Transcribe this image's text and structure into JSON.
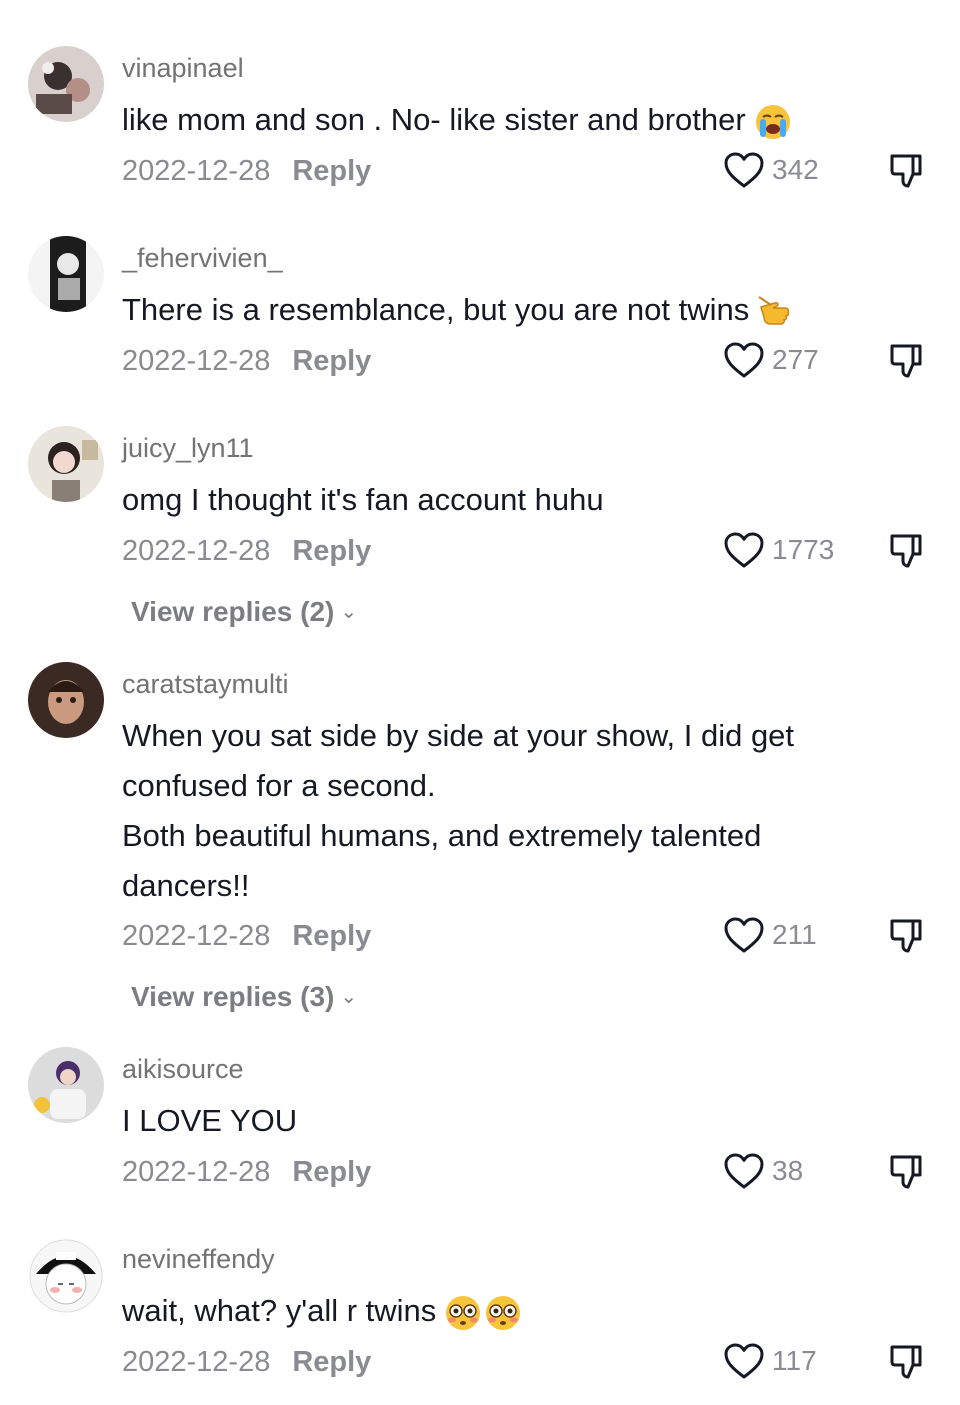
{
  "comments": [
    {
      "username": "vinapinael",
      "lines": [
        "like mom and son . No- like sister and brother"
      ],
      "emoji": [
        "loudly-crying-face"
      ],
      "date": "2022-12-28",
      "reply_label": "Reply",
      "likes": "342"
    },
    {
      "username": "_fehervivien_",
      "lines": [
        "There is a resemblance, but you are not twins"
      ],
      "emoji": [
        "backhand-index-pointing-left"
      ],
      "date": "2022-12-28",
      "reply_label": "Reply",
      "likes": "277"
    },
    {
      "username": "juicy_lyn11",
      "lines": [
        "omg I thought it's fan account huhu"
      ],
      "date": "2022-12-28",
      "reply_label": "Reply",
      "likes": "1773",
      "view_replies": "View replies (2)"
    },
    {
      "username": "caratstaymulti",
      "lines": [
        "When you sat side by side at your show, I did get",
        "confused for a second.",
        "Both beautiful humans, and extremely talented",
        "dancers!!"
      ],
      "date": "2022-12-28",
      "reply_label": "Reply",
      "likes": "211",
      "view_replies": "View replies (3)"
    },
    {
      "username": "aikisource",
      "lines": [
        "I LOVE YOU"
      ],
      "date": "2022-12-28",
      "reply_label": "Reply",
      "likes": "38"
    },
    {
      "username": "nevineffendy",
      "lines": [
        "wait, what? y'all r twins"
      ],
      "emoji": [
        "flushed-face",
        "flushed-face"
      ],
      "date": "2022-12-28",
      "reply_label": "Reply",
      "likes": "117"
    }
  ],
  "icons": {
    "like": "heart-outline-icon",
    "dislike": "thumbs-down-outline-icon",
    "view_replies_chevron": "chevron-down-icon"
  },
  "colors": {
    "text": "#161823",
    "username": "#737373",
    "meta": "#8a8b91",
    "icon_stroke": "#161823"
  }
}
